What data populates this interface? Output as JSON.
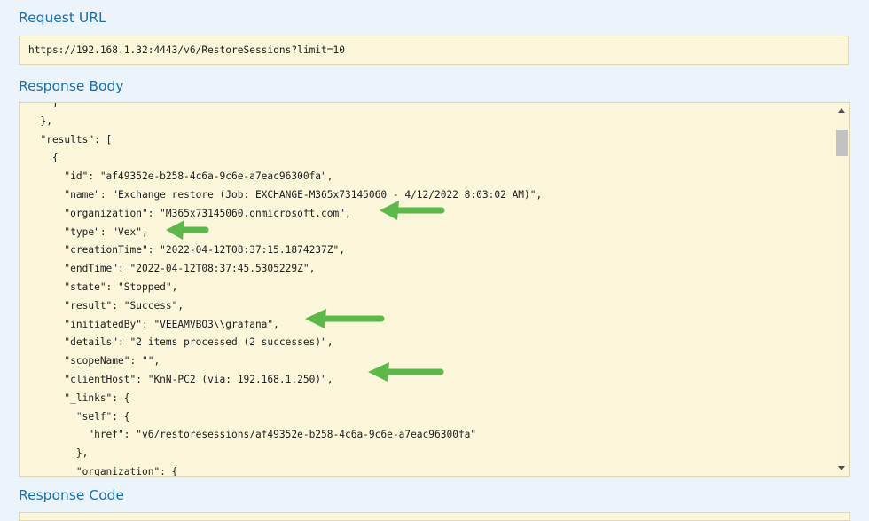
{
  "request_url": {
    "title": "Request URL",
    "value": "https://192.168.1.32:4443/v6/RestoreSessions?limit=10"
  },
  "response_body": {
    "title": "Response Body",
    "lines": [
      "    }",
      "  },",
      "  \"results\": [",
      "    {",
      "      \"id\": \"af49352e-b258-4c6a-9c6e-a7eac96300fa\",",
      "      \"name\": \"Exchange restore (Job: EXCHANGE-M365x73145060 - 4/12/2022 8:03:02 AM)\",",
      "      \"organization\": \"M365x73145060.onmicrosoft.com\",",
      "      \"type\": \"Vex\",",
      "      \"creationTime\": \"2022-04-12T08:37:15.1874237Z\",",
      "      \"endTime\": \"2022-04-12T08:37:45.5305229Z\",",
      "      \"state\": \"Stopped\",",
      "      \"result\": \"Success\",",
      "      \"initiatedBy\": \"VEEAMVBO3\\\\grafana\",",
      "      \"details\": \"2 items processed (2 successes)\",",
      "      \"scopeName\": \"\",",
      "      \"clientHost\": \"KnN-PC2 (via: 192.168.1.250)\",",
      "      \"_links\": {",
      "        \"self\": {",
      "          \"href\": \"v6/restoresessions/af49352e-b258-4c6a-9c6e-a7eac96300fa\"",
      "        },",
      "        \"organization\": {"
    ]
  },
  "response_code": {
    "title": "Response Code"
  },
  "colors": {
    "accent": "#1a6fb0",
    "code_bg": "#fcf6db",
    "arrow": "#5db84a"
  }
}
